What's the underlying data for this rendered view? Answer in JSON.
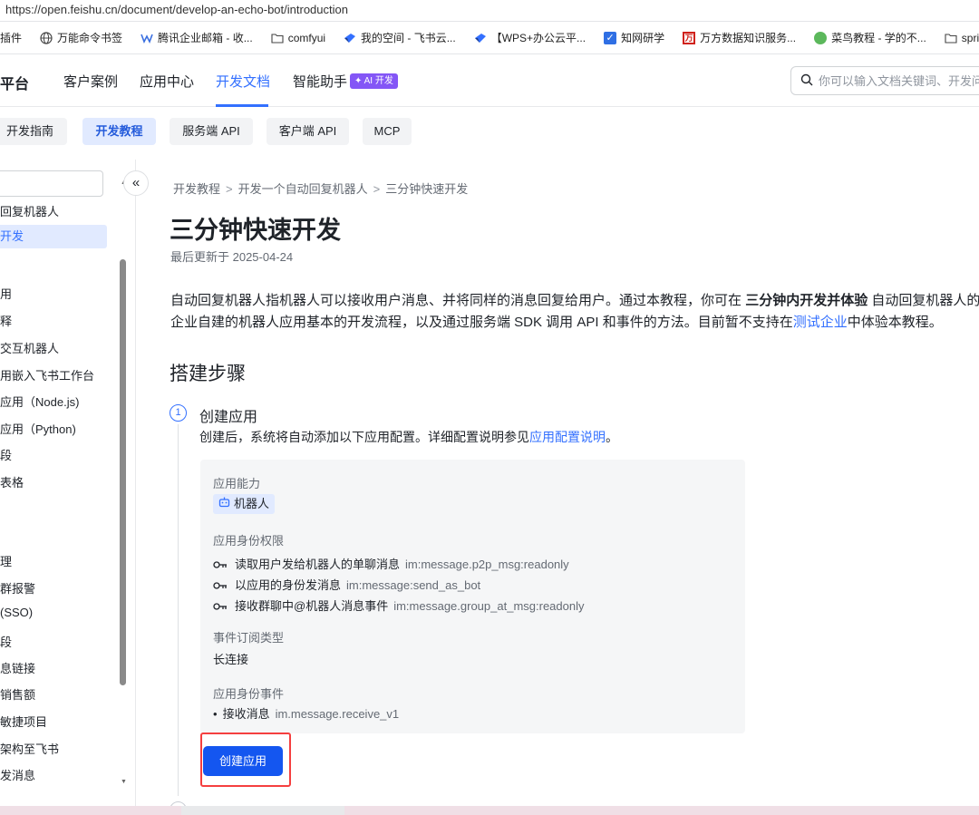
{
  "browser": {
    "url": "https://open.feishu.cn/document/develop-an-echo-bot/introduction",
    "bookmarks": [
      {
        "label": "插件",
        "icon": "extension-icon"
      },
      {
        "label": "万能命令书签",
        "icon": "globe-icon"
      },
      {
        "label": "腾讯企业邮箱 - 收...",
        "icon": "mail-icon"
      },
      {
        "label": "comfyui",
        "icon": "folder-icon"
      },
      {
        "label": "我的空间 - 飞书云...",
        "icon": "feishu-icon"
      },
      {
        "label": "【WPS+办公云平...",
        "icon": "feishu-icon"
      },
      {
        "label": "知网研学",
        "icon": "check-icon"
      },
      {
        "label": "万方数据知识服务...",
        "icon": "wanfang-icon"
      },
      {
        "label": "菜鸟教程 - 学的不...",
        "icon": "runoob-icon"
      },
      {
        "label": "spring bo",
        "icon": "folder-icon"
      }
    ]
  },
  "nav": {
    "brand": "平台",
    "items": [
      "客户案例",
      "应用中心",
      "开发文档",
      "智能助手"
    ],
    "active": "开发文档",
    "ai_badge": "✦ AI 开发",
    "search_placeholder": "你可以输入文档关键词、开发问"
  },
  "subtabs": [
    "开发指南",
    "开发教程",
    "服务端 API",
    "客户端 API",
    "MCP"
  ],
  "subtab_active": "开发教程",
  "sidebar": {
    "items": [
      "回复机器人",
      "开发",
      "用",
      "释",
      "交互机器人",
      "用嵌入飞书工作台",
      "应用（Node.js)",
      "应用（Python)",
      "段",
      "表格",
      "理",
      "群报警",
      "(SSO)",
      "段",
      "息链接",
      "销售额",
      "敏捷项目",
      "架构至飞书",
      "发消息"
    ],
    "active_item": "开发",
    "collapse_icon": "«"
  },
  "main": {
    "breadcrumb": [
      "开发教程",
      "开发一个自动回复机器人",
      "三分钟快速开发"
    ],
    "title": "三分钟快速开发",
    "updated": "最后更新于 2025-04-24",
    "intro_1a": "自动回复机器人指机器人可以接收用户消息、并将同样的消息回复给用户。通过本教程，你可在 ",
    "intro_1b": "三分钟内开发并体验",
    "intro_1c": " 自动回复机器人的效果",
    "intro_2a": "企业自建的机器人应用基本的开发流程，以及通过服务端 SDK 调用 API 和事件的方法。目前暂不支持在",
    "intro_2link": "测试企业",
    "intro_2b": "中体验本教程。",
    "section_title": "搭建步骤",
    "step1": {
      "number": "1",
      "title": "创建应用",
      "desc_a": "创建后，系统将自动添加以下应用配置。详细配置说明参见",
      "desc_link": "应用配置说明",
      "desc_b": "。"
    },
    "config": {
      "capability_label": "应用能力",
      "capability_tag": "机器人",
      "permissions_label": "应用身份权限",
      "permissions": [
        {
          "name": "读取用户发给机器人的单聊消息",
          "code": "im:message.p2p_msg:readonly"
        },
        {
          "name": "以应用的身份发消息",
          "code": "im:message:send_as_bot"
        },
        {
          "name": "接收群聊中@机器人消息事件",
          "code": "im:message.group_at_msg:readonly"
        }
      ],
      "event_type_label": "事件订阅类型",
      "event_type_value": "长连接",
      "events_label": "应用身份事件",
      "events": [
        {
          "name": "接收消息",
          "code": "im.message.receive_v1"
        }
      ]
    },
    "create_button": "创建应用"
  }
}
